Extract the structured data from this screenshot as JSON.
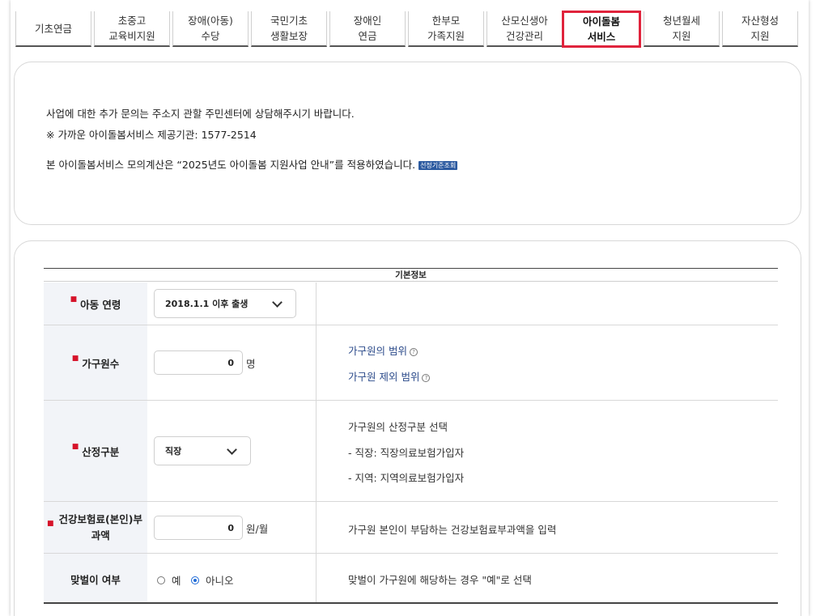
{
  "tabs": [
    {
      "line1": "기초연금",
      "line2": "",
      "active": false
    },
    {
      "line1": "초중고",
      "line2": "교육비지원",
      "active": false
    },
    {
      "line1": "장애(아동)",
      "line2": "수당",
      "active": false
    },
    {
      "line1": "국민기초",
      "line2": "생활보장",
      "active": false
    },
    {
      "line1": "장애인",
      "line2": "연금",
      "active": false
    },
    {
      "line1": "한부모",
      "line2": "가족지원",
      "active": false
    },
    {
      "line1": "산모신생아",
      "line2": "건강관리",
      "active": false
    },
    {
      "line1": "아이돌봄",
      "line2": "서비스",
      "active": true
    },
    {
      "line1": "청년월세",
      "line2": "지원",
      "active": false
    },
    {
      "line1": "자산형성",
      "line2": "지원",
      "active": false
    }
  ],
  "accent_color": "#e0233c",
  "info": {
    "line1": "사업에 대한 추가 문의는 주소지 관할 주민센터에 상담해주시기 바랍니다.",
    "line2": "※ 가까운 아이돌봄서비스 제공기관: 1577-2514",
    "line3": "본 아이돌봄서비스 모의계산은 “2025년도 아이돌봄 지원사업 안내”를 적용하였습니다.",
    "badge": "선정기준조회"
  },
  "form": {
    "section_title": "기본정보",
    "child_age": {
      "label": "아동 연령",
      "selected": "2018.1.1 이후 출생"
    },
    "household": {
      "label": "가구원수",
      "value": "0",
      "unit": "명",
      "link1": "가구원의 범위",
      "link2": "가구원 제외 범위"
    },
    "calc_type": {
      "label": "산정구분",
      "selected": "직장",
      "desc1": "가구원의 산정구분 선택",
      "desc2": "- 직장: 직장의료보험가입자",
      "desc3": "- 지역: 지역의료보험가입자"
    },
    "insurance": {
      "label": "건강보험료(본인)부과액",
      "value": "0",
      "unit": "원/월",
      "desc": "가구원 본인이 부담하는 건강보험료부과액을 입력"
    },
    "dual_income": {
      "label": "맞벌이 여부",
      "option_yes": "예",
      "option_no": "아니오",
      "selected": "아니오",
      "desc": "맞벌이 가구원에 해당하는 경우 \"예\"로 선택"
    }
  }
}
